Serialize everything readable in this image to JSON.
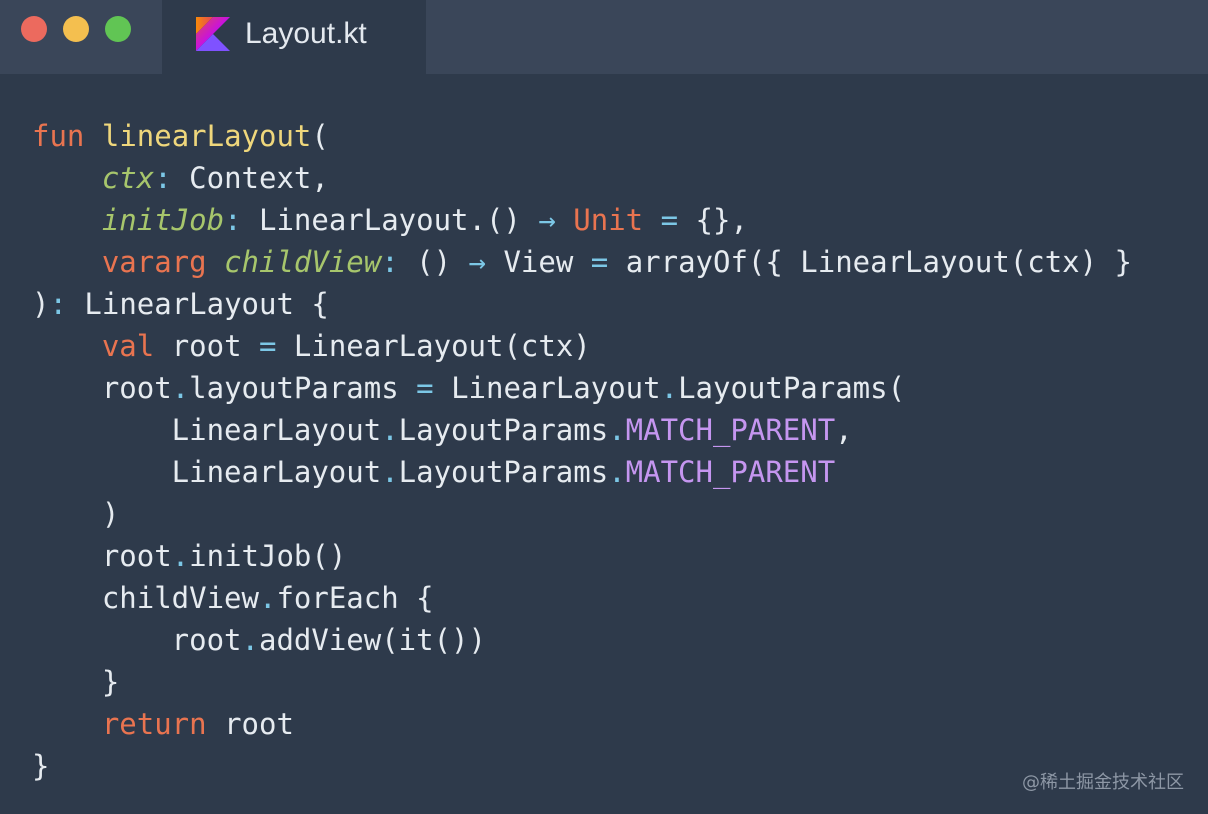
{
  "window": {
    "tab_title": "Layout.kt",
    "file_icon": "kotlin-icon",
    "controls": [
      "close-icon",
      "minimize-icon",
      "maximize-icon"
    ]
  },
  "code": {
    "lines": [
      [
        {
          "t": "fun",
          "c": "kw"
        },
        {
          "t": " ",
          "c": ""
        },
        {
          "t": "linearLayout",
          "c": "fn"
        },
        {
          "t": "(",
          "c": ""
        }
      ],
      [
        {
          "t": "    ",
          "c": ""
        },
        {
          "t": "ctx",
          "c": "param"
        },
        {
          "t": ":",
          "c": "op"
        },
        {
          "t": " Context,",
          "c": ""
        }
      ],
      [
        {
          "t": "    ",
          "c": ""
        },
        {
          "t": "initJob",
          "c": "param"
        },
        {
          "t": ":",
          "c": "op"
        },
        {
          "t": " LinearLayout.() ",
          "c": ""
        },
        {
          "t": "→",
          "c": "op"
        },
        {
          "t": " ",
          "c": ""
        },
        {
          "t": "Unit",
          "c": "kw"
        },
        {
          "t": " ",
          "c": ""
        },
        {
          "t": "=",
          "c": "op"
        },
        {
          "t": " {},",
          "c": ""
        }
      ],
      [
        {
          "t": "    ",
          "c": ""
        },
        {
          "t": "vararg",
          "c": "kw"
        },
        {
          "t": " ",
          "c": ""
        },
        {
          "t": "childView",
          "c": "param"
        },
        {
          "t": ":",
          "c": "op"
        },
        {
          "t": " () ",
          "c": ""
        },
        {
          "t": "→",
          "c": "op"
        },
        {
          "t": " View ",
          "c": ""
        },
        {
          "t": "=",
          "c": "op"
        },
        {
          "t": " arrayOf({ LinearLayout(ctx) }",
          "c": ""
        }
      ],
      [
        {
          "t": ")",
          "c": ""
        },
        {
          "t": ":",
          "c": "op"
        },
        {
          "t": " LinearLayout {",
          "c": ""
        }
      ],
      [
        {
          "t": "    ",
          "c": ""
        },
        {
          "t": "val",
          "c": "kw"
        },
        {
          "t": " root ",
          "c": ""
        },
        {
          "t": "=",
          "c": "op"
        },
        {
          "t": " LinearLayout(ctx)",
          "c": ""
        }
      ],
      [
        {
          "t": "    root",
          "c": ""
        },
        {
          "t": ".",
          "c": "op"
        },
        {
          "t": "layoutParams ",
          "c": ""
        },
        {
          "t": "=",
          "c": "op"
        },
        {
          "t": " LinearLayout",
          "c": ""
        },
        {
          "t": ".",
          "c": "op"
        },
        {
          "t": "LayoutParams(",
          "c": ""
        }
      ],
      [
        {
          "t": "        LinearLayout",
          "c": ""
        },
        {
          "t": ".",
          "c": "op"
        },
        {
          "t": "LayoutParams",
          "c": ""
        },
        {
          "t": ".",
          "c": "op"
        },
        {
          "t": "MATCH_PARENT",
          "c": "const"
        },
        {
          "t": ",",
          "c": ""
        }
      ],
      [
        {
          "t": "        LinearLayout",
          "c": ""
        },
        {
          "t": ".",
          "c": "op"
        },
        {
          "t": "LayoutParams",
          "c": ""
        },
        {
          "t": ".",
          "c": "op"
        },
        {
          "t": "MATCH_PARENT",
          "c": "const"
        }
      ],
      [
        {
          "t": "    )",
          "c": ""
        }
      ],
      [
        {
          "t": "    root",
          "c": ""
        },
        {
          "t": ".",
          "c": "op"
        },
        {
          "t": "initJob()",
          "c": ""
        }
      ],
      [
        {
          "t": "    childView",
          "c": ""
        },
        {
          "t": ".",
          "c": "op"
        },
        {
          "t": "forEach {",
          "c": ""
        }
      ],
      [
        {
          "t": "        root",
          "c": ""
        },
        {
          "t": ".",
          "c": "op"
        },
        {
          "t": "addView(it())",
          "c": ""
        }
      ],
      [
        {
          "t": "    }",
          "c": ""
        }
      ],
      [
        {
          "t": "    ",
          "c": ""
        },
        {
          "t": "return",
          "c": "kw"
        },
        {
          "t": " root",
          "c": ""
        }
      ],
      [
        {
          "t": "}",
          "c": ""
        }
      ]
    ]
  },
  "watermark": "@稀土掘金技术社区",
  "colors": {
    "background": "#2e3a4b",
    "titlebar": "#3a4659",
    "keyword": "#e97450",
    "function": "#efd77c",
    "parameter": "#a7c66c",
    "operator": "#7cc7e6",
    "constant": "#c596f0",
    "text": "#e6ebf0"
  }
}
